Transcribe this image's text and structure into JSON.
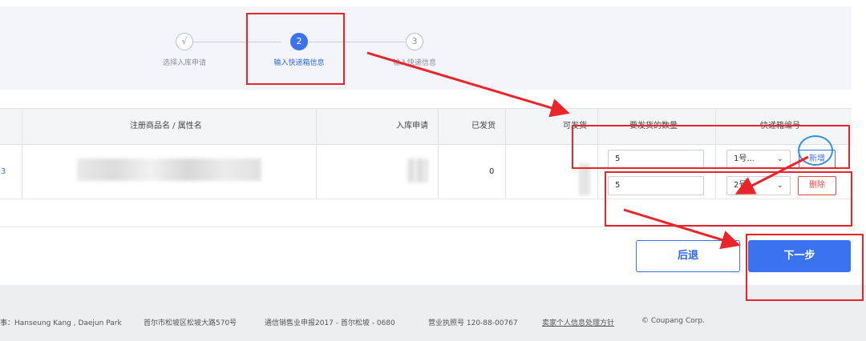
{
  "stepper": {
    "steps": [
      {
        "marker": "√",
        "label": "选择入库申请"
      },
      {
        "marker": "2",
        "label": "输入快递箱信息"
      },
      {
        "marker": "3",
        "label": "输入快递信息"
      }
    ]
  },
  "table": {
    "headers": {
      "product": "注册商品名 / 属性名",
      "request": "入库申请",
      "shipped": "已发货",
      "available": "可发货",
      "qty": "要发货的数量",
      "box": "快递箱编号"
    },
    "row": {
      "id_fragment": "3",
      "shipped": "0",
      "entries": [
        {
          "qty": "5",
          "box": "1号...",
          "action": "新增"
        },
        {
          "qty": "5",
          "box": "2号",
          "action": "删除"
        }
      ]
    }
  },
  "buttons": {
    "back": "后退",
    "next": "下一步"
  },
  "footer": {
    "ceo": "事：Hanseung Kang , Daejun Park",
    "address": "首尔市松坡区松坡大路570号",
    "ecommerce": "通信销售业申报2017 - 首尔松坡 - 0680",
    "business_no": "营业执照号 120-88-00767",
    "privacy": "卖家个人信息处理方针",
    "copyright": "© Coupang Corp."
  },
  "colors": {
    "accent": "#3a72f0",
    "danger": "#e2484d",
    "annotation_red": "#e9252b",
    "annotation_blue": "#2f8fe8"
  }
}
